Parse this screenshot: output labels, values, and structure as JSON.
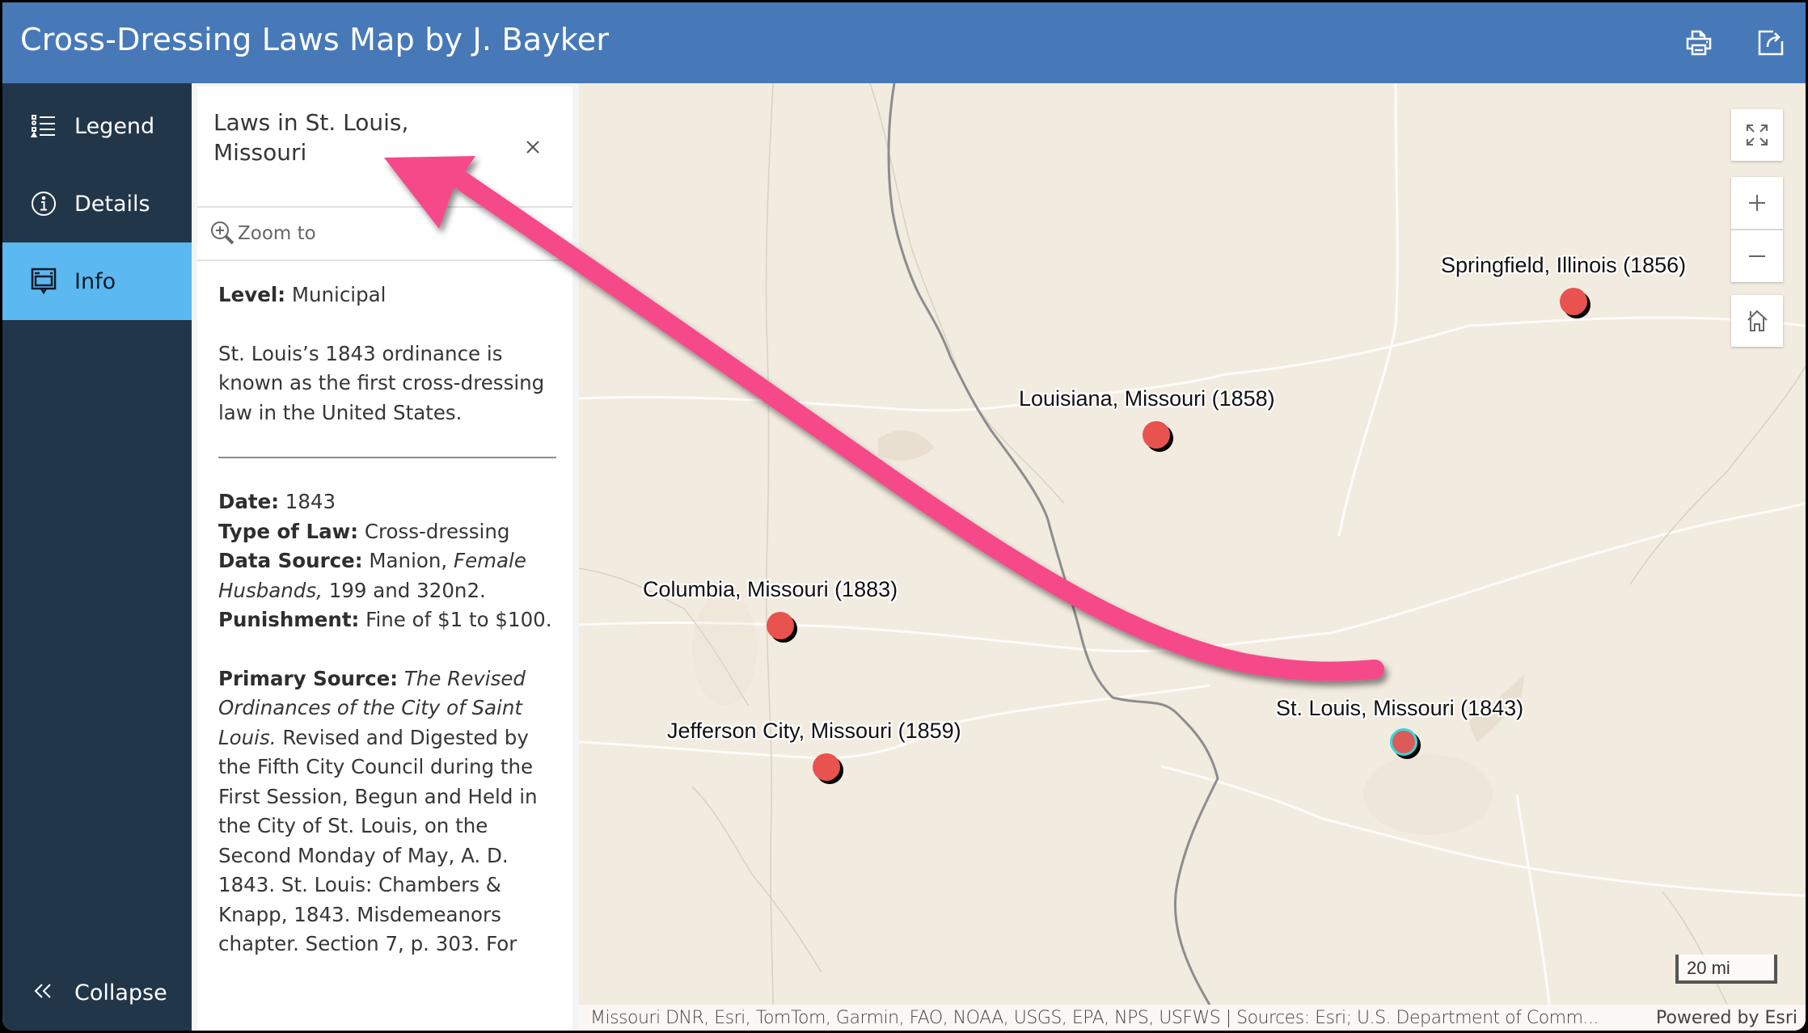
{
  "header": {
    "title": "Cross-Dressing Laws Map by J. Bayker",
    "print_icon": "printer-icon",
    "share_icon": "share-icon"
  },
  "sidebar": {
    "items": [
      {
        "label": "Legend",
        "icon": "legend-list-icon",
        "active": false
      },
      {
        "label": "Details",
        "icon": "info-circle-icon",
        "active": false
      },
      {
        "label": "Info",
        "icon": "popup-window-icon",
        "active": true
      }
    ],
    "collapse": {
      "label": "Collapse",
      "icon": "double-chevron-left-icon"
    }
  },
  "panel": {
    "title": "Laws in St. Louis, Missouri",
    "close_icon": "close-icon",
    "zoom_to": "Zoom to",
    "level_label": "Level:",
    "level_value": "Municipal",
    "summary": "St. Louis’s 1843 ordinance is known as the first cross-dressing law in the United States.",
    "date_label": "Date:",
    "date_value": "1843",
    "type_label": "Type of Law:",
    "type_value": "Cross-dressing",
    "data_source_label": "Data Source:",
    "data_source_value_1": "Manion,",
    "data_source_title": "Female Husbands,",
    "data_source_value_2": "199 and 320n2.",
    "punishment_label": "Punishment:",
    "punishment_value": "Fine of $1 to $100.",
    "primary_source_label": "Primary Source:",
    "primary_source_title": "The Revised Ordinances of the City of Saint Louis.",
    "primary_source_text": "Revised and Digested by the Fifth City Council during the First Session, Begun and Held in the City of St. Louis, on the Second Monday of May, A. D. 1843. St. Louis: Chambers & Knapp, 1843. Misdemeanors chapter. Section 7, p. 303. For"
  },
  "map": {
    "controls": {
      "fullscreen": "expand-icon",
      "zoom_in": "+",
      "zoom_out": "−",
      "home": "home-icon"
    },
    "cities": [
      {
        "label": "Springfield, Illinois (1856)",
        "selected": false
      },
      {
        "label": "Louisiana, Missouri (1858)",
        "selected": false
      },
      {
        "label": "Columbia, Missouri (1883)",
        "selected": false
      },
      {
        "label": "Jefferson City, Missouri (1859)",
        "selected": false
      },
      {
        "label": "St. Louis, Missouri (1843)",
        "selected": true
      }
    ],
    "scale": "20 mi",
    "attribution": "Missouri DNR, Esri, TomTom, Garmin, FAO, NOAA, USGS, EPA, NPS, USFWS | Sources: Esri; U.S. Department of Comm...",
    "powered_by": "Powered by Esri",
    "marker_color": "#e8524f",
    "selection_color": "#38d7da"
  },
  "annotation": {
    "arrow_color": "#f5498a"
  }
}
